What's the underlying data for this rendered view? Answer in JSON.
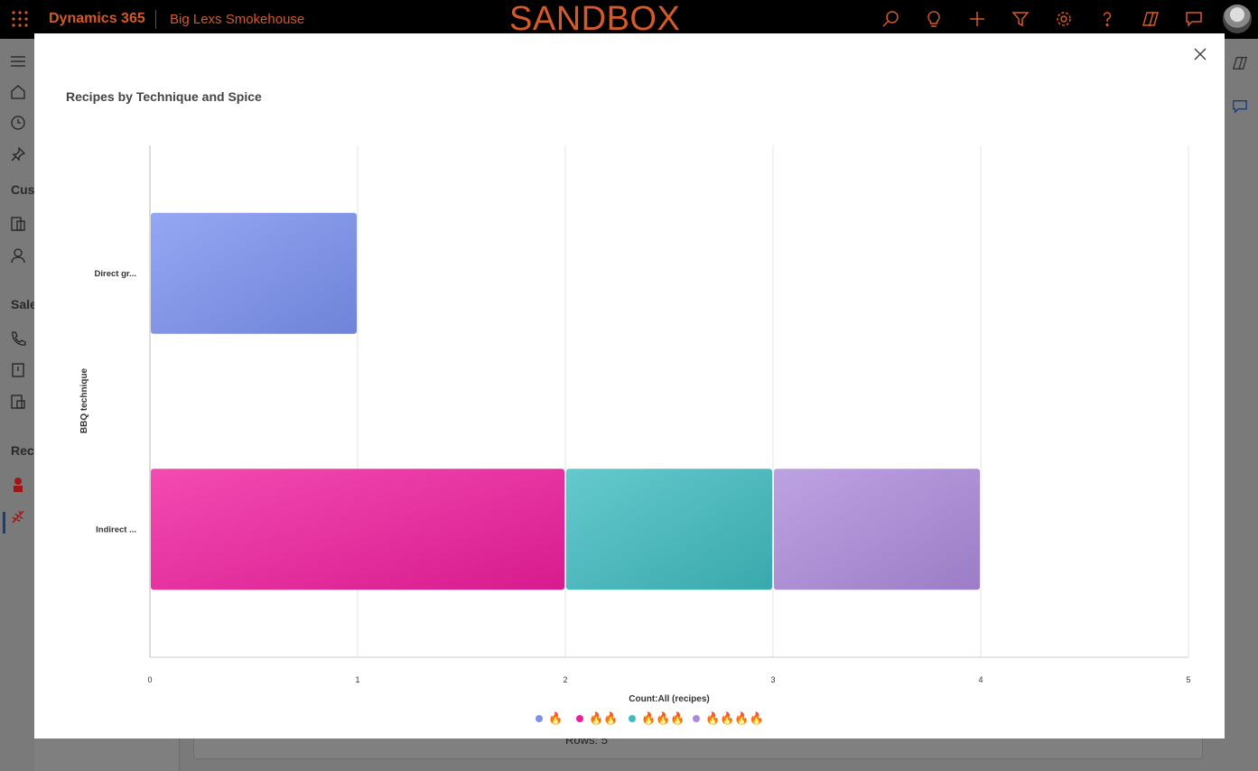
{
  "topbar": {
    "brand": "Dynamics 365",
    "app_name": "Big Lexs Smokehouse",
    "environment_banner": "SANDBOX",
    "icons": [
      "search-icon",
      "lightbulb-icon",
      "plus-icon",
      "filter-icon",
      "settings-icon",
      "help-icon",
      "copilot-icon",
      "chat-icon"
    ]
  },
  "leftnav": {
    "section_labels": [
      "Cust",
      "Sale",
      "Reci"
    ]
  },
  "background": {
    "rows_text": "Rows: 5"
  },
  "modal": {
    "close_label": "Close"
  },
  "colors": {
    "topbar_bg": "#000000",
    "brand_orange": "#d45a2a",
    "series_1": "#7b91f0",
    "series_2": "#f01e9e",
    "series_3": "#3fbcc0",
    "series_4": "#ad8bdc"
  },
  "chart_data": {
    "type": "bar",
    "orientation": "horizontal",
    "stacked": true,
    "title": "Recipes by Technique and Spice",
    "xlabel": "Count:All (recipes)",
    "ylabel": "BBQ technique",
    "categories": [
      "Direct gr...",
      "Indirect ..."
    ],
    "xlim": [
      0,
      5
    ],
    "xticks": [
      "0",
      "1",
      "2",
      "3",
      "4",
      "5"
    ],
    "grid": true,
    "legend_position": "bottom",
    "series": [
      {
        "name": "🔥",
        "color": "#7b91f0",
        "values": [
          1,
          0
        ]
      },
      {
        "name": "🔥🔥",
        "color": "#f01e9e",
        "values": [
          0,
          2
        ]
      },
      {
        "name": "🔥🔥🔥",
        "color": "#3fbcc0",
        "values": [
          0,
          1
        ]
      },
      {
        "name": "🔥🔥🔥🔥",
        "color": "#ad8bdc",
        "values": [
          0,
          1
        ]
      }
    ]
  }
}
